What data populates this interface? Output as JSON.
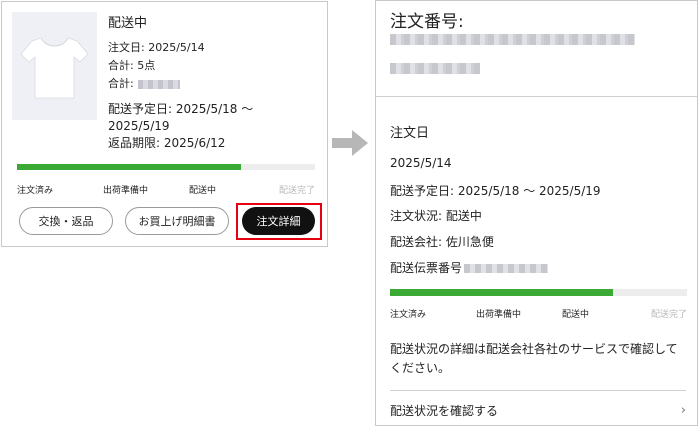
{
  "left_card": {
    "status": "配送中",
    "order_date": "注文日: 2025/5/14",
    "items_total": "合計: 5点",
    "total_price_label": "合計:",
    "delivery_date_line1": "配送予定日: 2025/5/18 〜",
    "delivery_date_line2": "2025/5/19",
    "return_deadline": "返品期限: 2025/6/12",
    "progress_fraction": 0.75,
    "steps": [
      "注文済み",
      "出荷準備中",
      "配送中",
      "配送完了"
    ],
    "buttons": {
      "exchange": "交換・返品",
      "receipt": "お買上げ明細書",
      "detail": "注文詳細"
    }
  },
  "right_card": {
    "order_no_label": "注文番号:",
    "section_title": "注文日",
    "order_date": "2025/5/14",
    "delivery_date": "配送予定日: 2025/5/18 〜 2025/5/19",
    "order_status": "注文状況: 配送中",
    "carrier": "配送会社: 佐川急便",
    "tracking_label": "配送伝票番号",
    "progress_fraction": 0.75,
    "steps": [
      "注文済み",
      "出荷準備中",
      "配送中",
      "配送完了"
    ],
    "note": "配送状況の詳細は配送会社各社のサービスで確認してください。",
    "confirm_link": "配送状況を確認する"
  },
  "colors": {
    "progress": "#3aaa35",
    "highlight_border": "#e60012",
    "primary_button": "#111111"
  },
  "icons": {
    "arrow": "right-arrow-icon",
    "chevron": "chevron-right-icon",
    "product": "tshirt-image"
  }
}
